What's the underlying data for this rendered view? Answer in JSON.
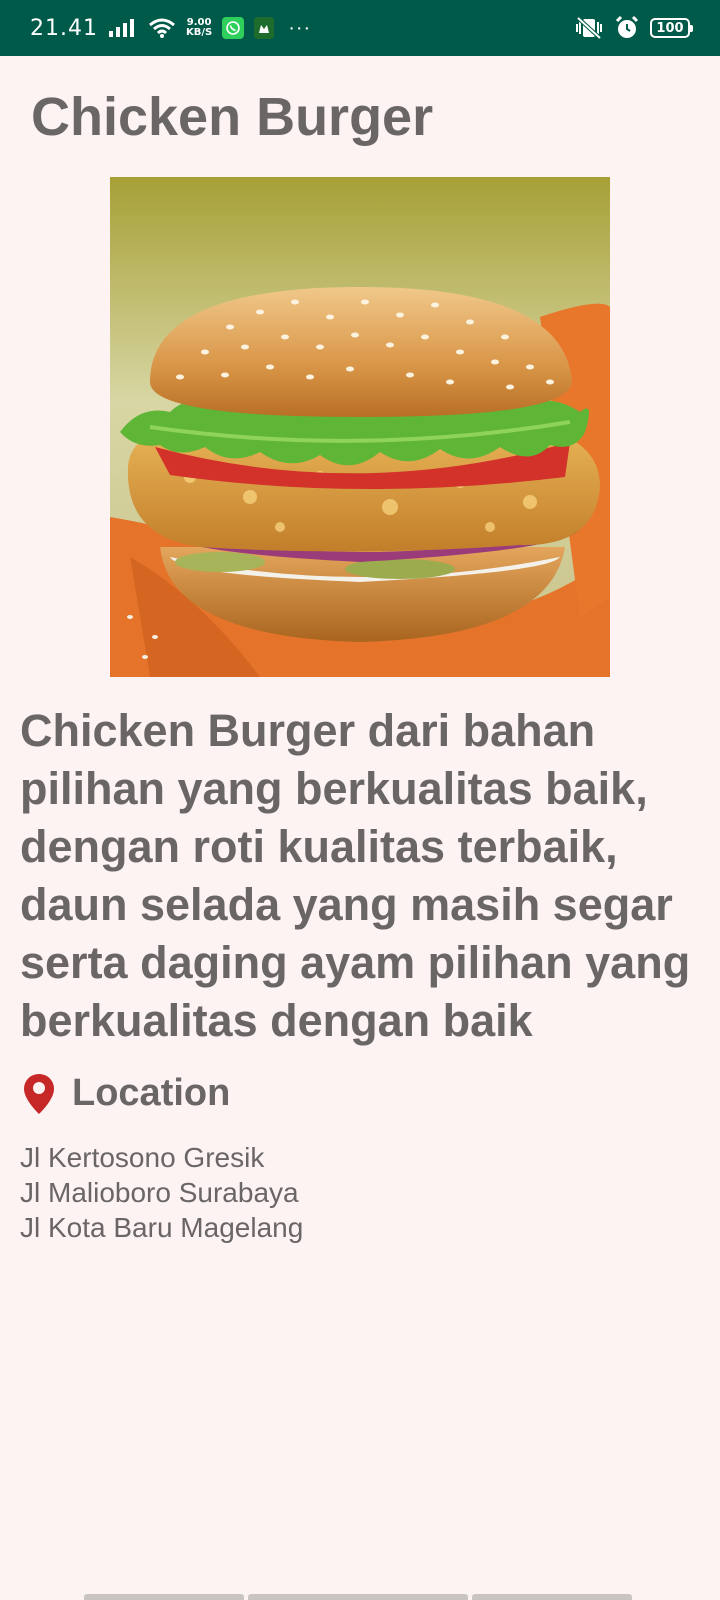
{
  "status_bar": {
    "time": "21.41",
    "net_speed_value": "9.00",
    "net_speed_unit": "KB/S",
    "more": "···",
    "battery": "100"
  },
  "page": {
    "title": "Chicken Burger",
    "image_alt": "chicken-burger-photo",
    "description": "Chicken Burger dari bahan pilihan yang berkualitas baik, dengan roti kualitas terbaik, daun selada yang masih segar serta daging ayam pilihan yang berkualitas dengan baik",
    "location_label": "Location",
    "locations": [
      "Jl Kertosono Gresik",
      "Jl Malioboro Surabaya",
      "Jl Kota Baru Magelang"
    ]
  },
  "colors": {
    "status_bar": "#005a49",
    "background": "#fcf3f2",
    "text": "#6b6666",
    "pin": "#c62828"
  }
}
